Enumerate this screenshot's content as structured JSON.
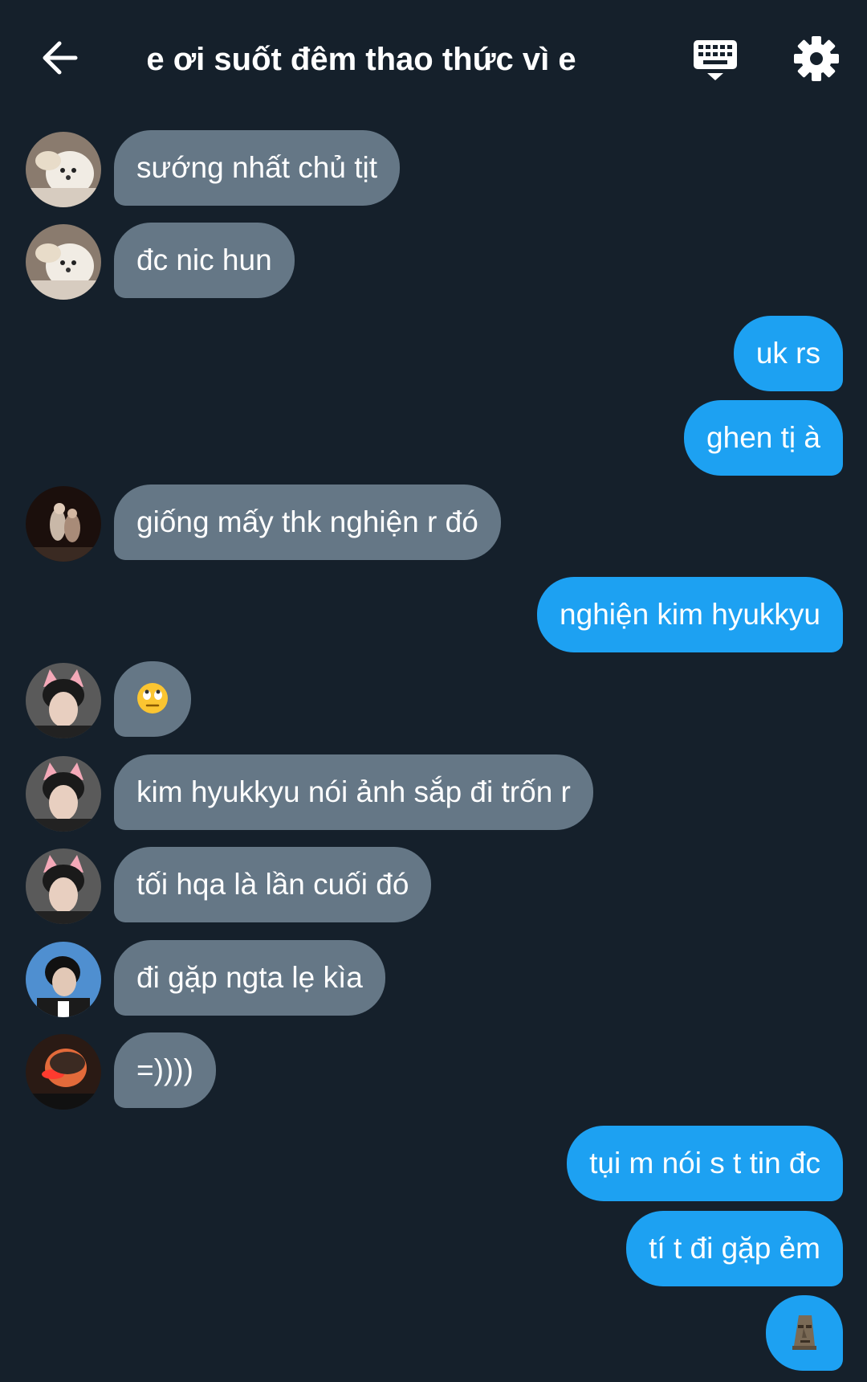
{
  "header": {
    "title": "e ơi suốt đêm thao thức vì e",
    "back_icon": "arrow-left-icon",
    "keyboard_icon": "keyboard-icon",
    "settings_icon": "gear-icon"
  },
  "colors": {
    "background": "#15202b",
    "incoming_bubble": "#657786",
    "outgoing_bubble": "#1da1f2",
    "text": "#ffffff"
  },
  "messages": [
    {
      "side": "in",
      "avatar": "dog-avatar",
      "text": "sướng nhất chủ tịt"
    },
    {
      "side": "in",
      "avatar": "dog-avatar",
      "text": "đc nic hun"
    },
    {
      "side": "out",
      "text": "uk rs"
    },
    {
      "side": "out",
      "text": "ghen tị à"
    },
    {
      "side": "in",
      "avatar": "dark-photo-avatar",
      "text": "giống mấy thk nghiện r đó"
    },
    {
      "side": "out",
      "text": "nghiện kim hyukkyu"
    },
    {
      "side": "in",
      "avatar": "cat-ears-avatar",
      "text": "",
      "emoji": "eye-roll-emoji"
    },
    {
      "side": "in",
      "avatar": "cat-ears-avatar",
      "text": "kim hyukkyu nói ảnh sắp đi trốn r"
    },
    {
      "side": "in",
      "avatar": "cat-ears-avatar",
      "text": "tối hqa là lần cuối đó"
    },
    {
      "side": "in",
      "avatar": "blue-photo-avatar",
      "text": "đi gặp ngta lẹ kìa"
    },
    {
      "side": "in",
      "avatar": "red-photo-avatar",
      "text": "=))))"
    },
    {
      "side": "out",
      "text": "tụi m nói s t tin đc"
    },
    {
      "side": "out",
      "text": "tí t đi gặp ẻm"
    },
    {
      "side": "out",
      "text": "",
      "emoji": "moai-emoji"
    }
  ]
}
